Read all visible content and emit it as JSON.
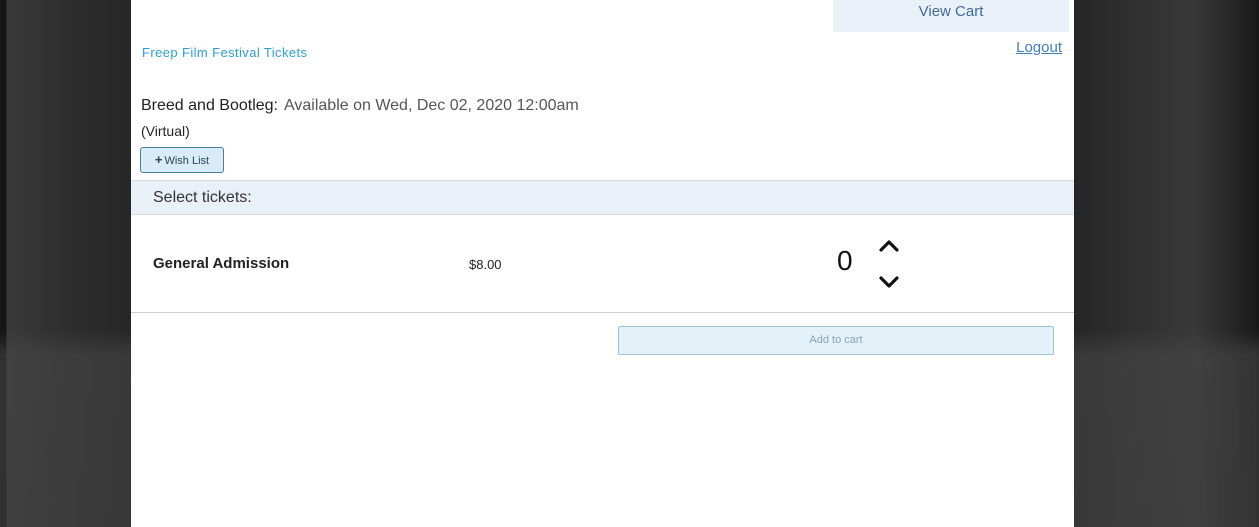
{
  "header": {
    "view_cart_label": "View Cart",
    "brand": "Freep Film Festival Tickets",
    "logout_label": "Logout"
  },
  "event": {
    "title": "Breed and Bootleg:",
    "availability": "Available on Wed, Dec 02, 2020 12:00am",
    "format": "(Virtual)",
    "wish_list_label": "Wish List"
  },
  "tickets": {
    "section_label": "Select tickets:",
    "rows": [
      {
        "name": "General Admission",
        "price": "$8.00",
        "quantity": "0"
      }
    ],
    "add_to_cart_label": "Add to cart"
  },
  "icons": {
    "increment": "chevron-up-icon",
    "decrement": "chevron-down-icon",
    "wish": "plus-icon"
  },
  "colors": {
    "brand": "#2aa0d6",
    "link": "#3d7fbf",
    "bar_background": "#eaf0f8",
    "button_background": "#d8ebf7"
  }
}
